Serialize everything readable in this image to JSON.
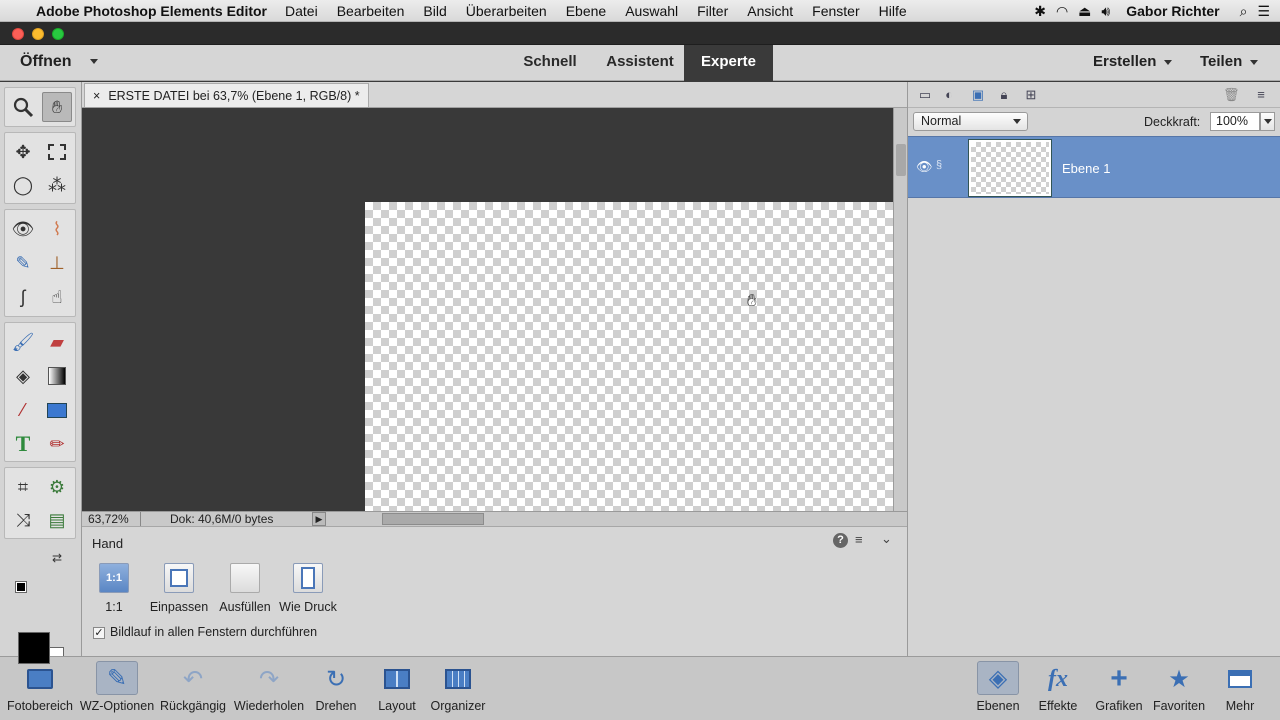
{
  "menubar": {
    "app_name": "Adobe Photoshop Elements Editor",
    "items": [
      "Datei",
      "Bearbeiten",
      "Bild",
      "Überarbeiten",
      "Ebene",
      "Auswahl",
      "Filter",
      "Ansicht",
      "Fenster",
      "Hilfe"
    ],
    "user": "Gabor Richter"
  },
  "modebar": {
    "open_label": "Öffnen",
    "tabs": [
      "Schnell",
      "Assistent",
      "Experte"
    ],
    "active_tab": "Experte",
    "create_label": "Erstellen",
    "share_label": "Teilen"
  },
  "document": {
    "tab_title": "ERSTE DATEI bei 63,7% (Ebene 1, RGB/8) *",
    "close_glyph": "×",
    "zoom": "63,72%",
    "doc_size": "Dok: 40,6M/0 bytes"
  },
  "tool_options": {
    "title": "Hand",
    "buttons": [
      "1:1",
      "Einpassen",
      "Ausfüllen",
      "Wie Druck"
    ],
    "button_glyph_1to1": "1:1",
    "checkbox_label": "Bildlauf in allen Fenstern durchführen",
    "checkbox_checked": true
  },
  "layers_panel": {
    "blend_mode": "Normal",
    "opacity_label": "Deckkraft:",
    "opacity_value": "100%",
    "layers": [
      {
        "name": "Ebene 1",
        "visible": true,
        "selected": true
      }
    ]
  },
  "taskbar": {
    "left": [
      {
        "label": "Fotobereich",
        "icon": "photo-bin-icon"
      },
      {
        "label": "WZ-Optionen",
        "icon": "tool-options-icon",
        "selected": true
      },
      {
        "label": "Rückgängig",
        "icon": "undo-icon"
      },
      {
        "label": "Wiederholen",
        "icon": "redo-icon"
      },
      {
        "label": "Drehen",
        "icon": "rotate-icon"
      },
      {
        "label": "Layout",
        "icon": "layout-icon"
      },
      {
        "label": "Organizer",
        "icon": "organizer-icon"
      }
    ],
    "right": [
      {
        "label": "Ebenen",
        "icon": "layers-icon",
        "selected": true
      },
      {
        "label": "Effekte",
        "icon": "fx-icon"
      },
      {
        "label": "Grafiken",
        "icon": "plus-icon"
      },
      {
        "label": "Favoriten",
        "icon": "star-icon"
      },
      {
        "label": "Mehr",
        "icon": "more-icon"
      }
    ]
  },
  "colors": {
    "accent": "#6990c8",
    "foreground_color": "#000000",
    "background_color": "#ffffff"
  }
}
